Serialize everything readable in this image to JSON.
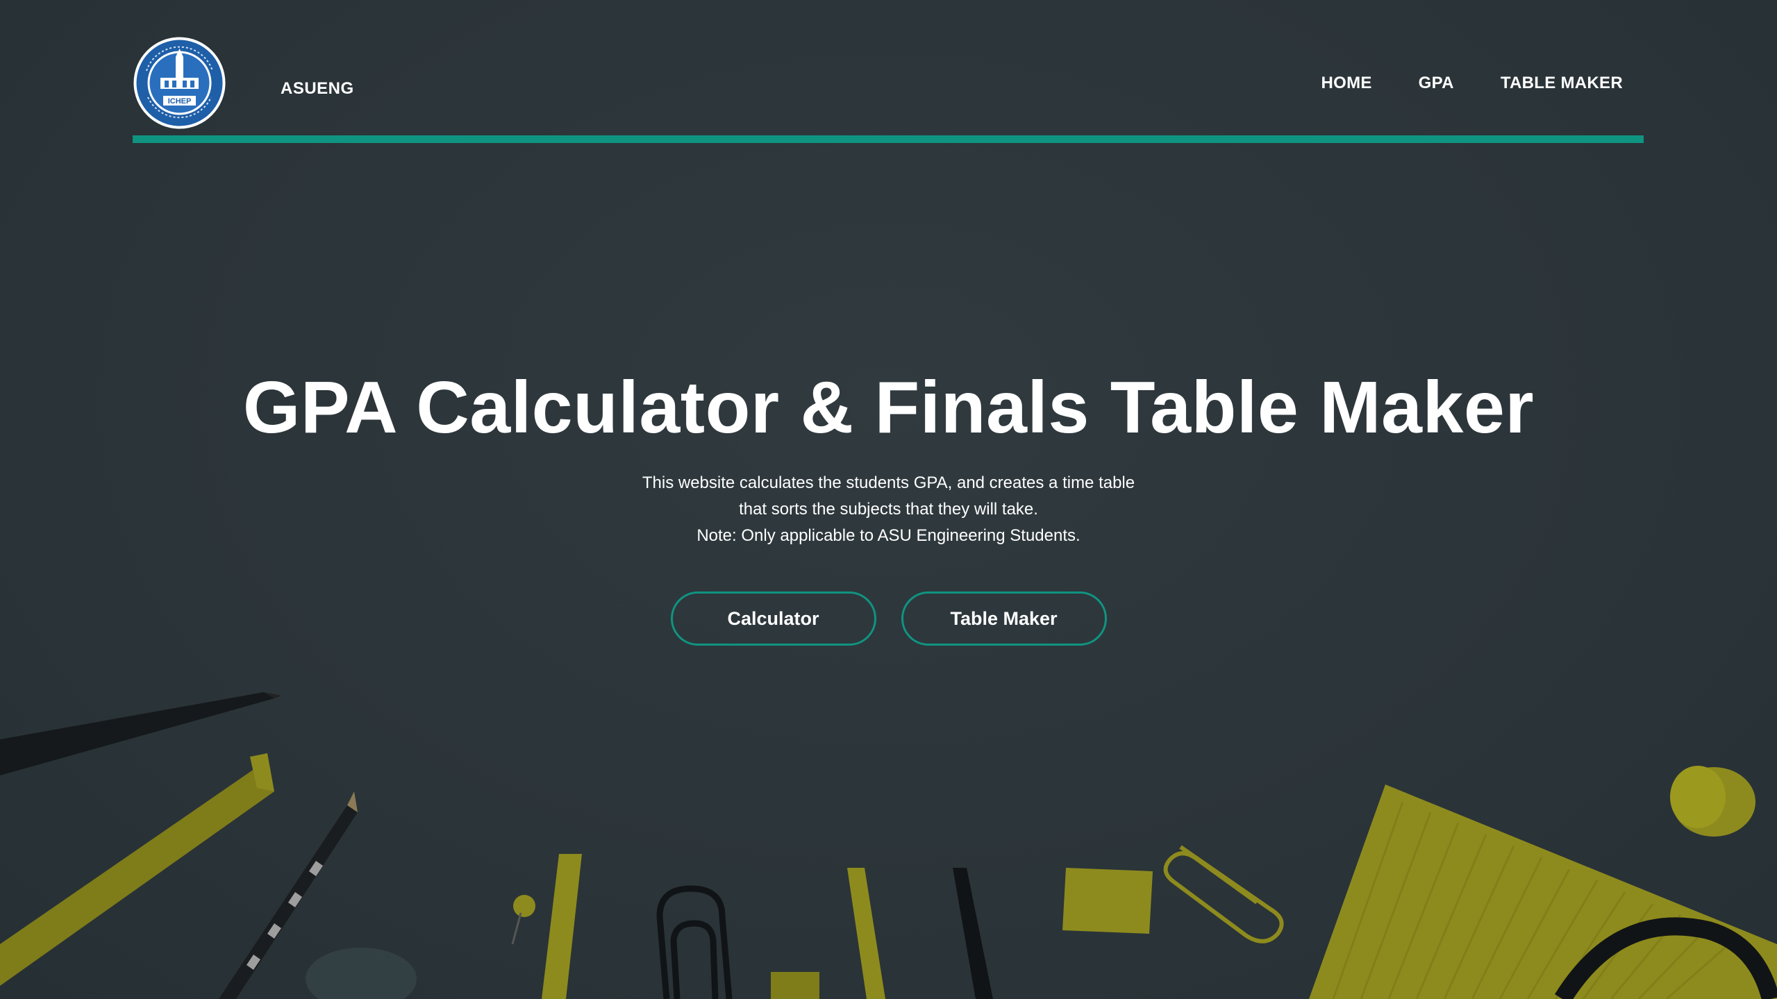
{
  "header": {
    "brand": "ASUENG",
    "logo_text": "ICHEP",
    "logo_ring_text": "Faculty of Engineering · Ain Shams University",
    "nav": [
      {
        "label": "HOME"
      },
      {
        "label": "GPA"
      },
      {
        "label": "TABLE MAKER"
      }
    ]
  },
  "hero": {
    "title": "GPA Calculator & Finals Table Maker",
    "desc_lines": [
      "This website calculates the students GPA, and creates a time table",
      "that sorts the subjects that they will take.",
      "Note: Only applicable to ASU Engineering Students."
    ],
    "buttons": {
      "calculator": "Calculator",
      "table_maker": "Table Maker"
    }
  },
  "colors": {
    "background": "#2c353a",
    "accent": "#0f9482",
    "text": "#ffffff",
    "decor_yellow": "#8c8a1c"
  }
}
